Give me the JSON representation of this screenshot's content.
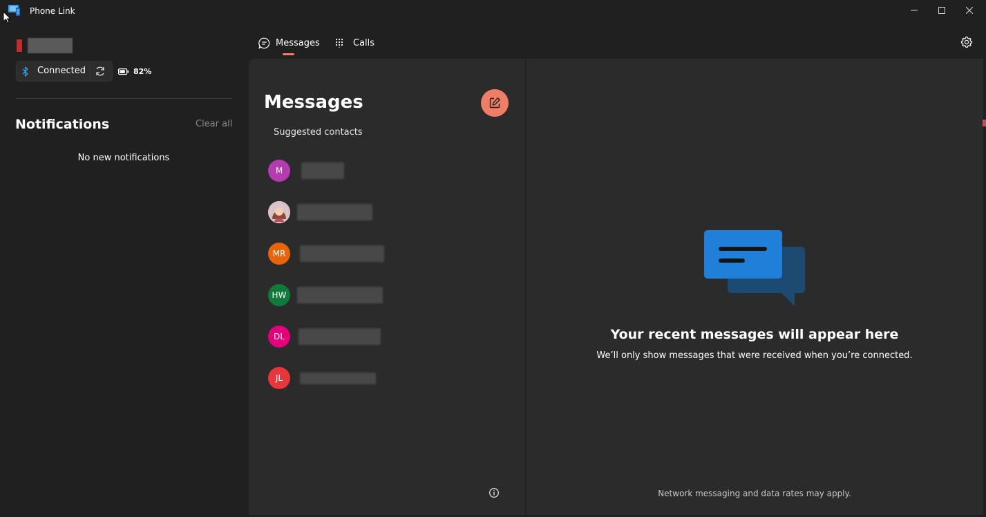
{
  "window": {
    "title": "Phone Link",
    "controls": [
      "minimize-icon",
      "maximize-icon",
      "close-icon"
    ]
  },
  "device": {
    "status_label": "Connected",
    "battery": "82%",
    "connection_icon": "bluetooth-icon"
  },
  "notifications": {
    "title": "Notifications",
    "clear_label": "Clear all",
    "empty_label": "No new notifications"
  },
  "tabs": [
    {
      "label": "Messages",
      "icon": "chat-icon",
      "selected": true
    },
    {
      "label": "Calls",
      "icon": "dialpad-icon",
      "selected": false
    }
  ],
  "messages": {
    "heading": "Messages",
    "suggested_label": "Suggested contacts",
    "contacts": [
      {
        "initials": "M",
        "color": "#b43cb0"
      },
      {
        "initials": "",
        "color": "#d9b8c0",
        "photo": true
      },
      {
        "initials": "MR",
        "color": "#e8630a"
      },
      {
        "initials": "HW",
        "color": "#0f7a3a"
      },
      {
        "initials": "DL",
        "color": "#e3007b"
      },
      {
        "initials": "JL",
        "color": "#e8363c"
      }
    ]
  },
  "empty_state": {
    "title": "Your recent messages will appear here",
    "subtitle": "We’ll only show messages that were received when you’re connected."
  },
  "footer_note": "Network messaging and data rates may apply.",
  "colors": {
    "accent": "#f07e66",
    "background": "#202020",
    "panel": "#2b2b2b",
    "illustration_front": "#1f7fd9",
    "illustration_back": "#1d4a70"
  }
}
